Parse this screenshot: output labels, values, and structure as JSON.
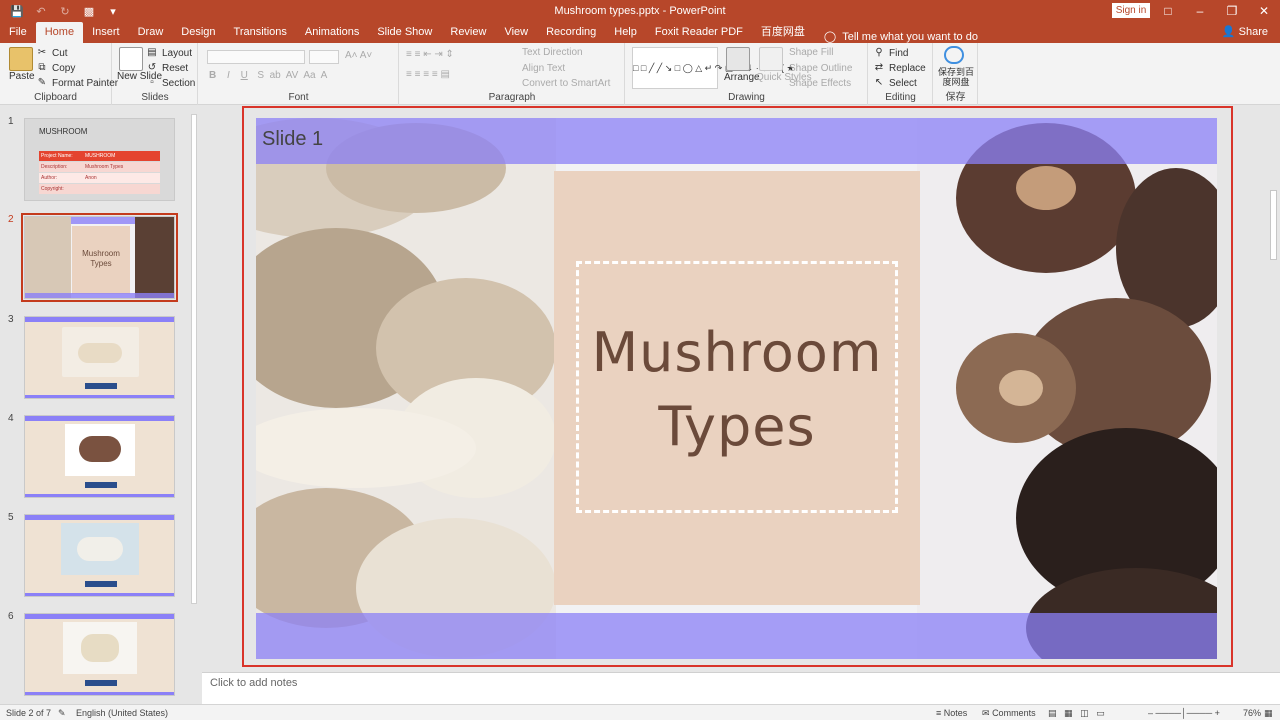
{
  "window": {
    "title": "Mushroom types.pptx  -  PowerPoint",
    "signin": "Sign in",
    "share": "Share"
  },
  "tabs": [
    "File",
    "Home",
    "Insert",
    "Draw",
    "Design",
    "Transitions",
    "Animations",
    "Slide Show",
    "Review",
    "View",
    "Recording",
    "Help",
    "Foxit Reader PDF",
    "百度网盘"
  ],
  "tell_me": "Tell me what you want to do",
  "ribbon": {
    "clipboard": {
      "label": "Clipboard",
      "paste": "Paste",
      "cut": "Cut",
      "copy": "Copy",
      "format_painter": "Format Painter"
    },
    "slides": {
      "label": "Slides",
      "new_slide": "New Slide",
      "layout": "Layout",
      "reset": "Reset",
      "section": "Section"
    },
    "font": {
      "label": "Font"
    },
    "paragraph": {
      "label": "Paragraph",
      "text_direction": "Text Direction",
      "align_text": "Align Text",
      "convert_smartart": "Convert to SmartArt"
    },
    "drawing": {
      "label": "Drawing",
      "arrange": "Arrange",
      "quick_styles": "Quick Styles",
      "shape_fill": "Shape Fill",
      "shape_outline": "Shape Outline",
      "shape_effects": "Shape Effects"
    },
    "editing": {
      "label": "Editing",
      "find": "Find",
      "replace": "Replace",
      "select": "Select"
    },
    "save": {
      "label": "保存",
      "button": "保存到百度网盘"
    }
  },
  "thumbnails": [
    {
      "num": "1",
      "title": "MUSHROOM",
      "rows": [
        [
          "Project Name:",
          "MUSHROOM"
        ],
        [
          "Description:",
          "Mushroom Types"
        ],
        [
          "Author:",
          "Anon"
        ],
        [
          "Copyright:",
          ""
        ]
      ]
    },
    {
      "num": "2",
      "text": "Mushroom Types"
    },
    {
      "num": "3"
    },
    {
      "num": "4"
    },
    {
      "num": "5"
    },
    {
      "num": "6"
    }
  ],
  "slide": {
    "label": "Slide 1",
    "title_line1": "Mushroom",
    "title_line2": "Types"
  },
  "notes_placeholder": "Click to add notes",
  "status": {
    "slide_of": "Slide 2 of 7",
    "language": "English (United States)",
    "notes": "Notes",
    "comments": "Comments",
    "zoom": "76%"
  },
  "colors": {
    "accent": "#b7472a",
    "band": "#8b80f7",
    "title": "#6b4a3a"
  }
}
